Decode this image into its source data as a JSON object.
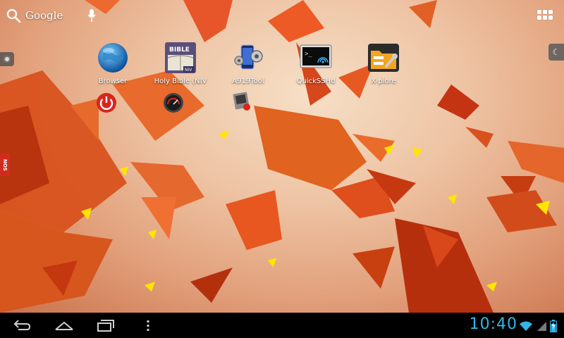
{
  "search": {
    "label": "Google"
  },
  "icons": [
    {
      "label": "Browser",
      "icon": "globe-icon"
    },
    {
      "label": "Holy Bible (NIV",
      "icon": "bible-book-icon",
      "badge_title": "BIBLE",
      "badge_sub": "NIV"
    },
    {
      "label": "A919Tool",
      "icon": "phone-gear-icon"
    },
    {
      "label": "QuickSSHd",
      "icon": "terminal-icon",
      "terminal_text": ">_"
    },
    {
      "label": "X-plore",
      "icon": "folder-tools-icon"
    }
  ],
  "second_row_icons": [
    "power-icon",
    "speedometer-icon",
    "media-player-icon"
  ],
  "side_badge": {
    "text": "NOS"
  },
  "statusbar": {
    "time": "10:40",
    "wifi": "wifi-icon",
    "battery": "battery-charging-icon"
  },
  "navbar": {
    "buttons": [
      "back-icon",
      "home-icon",
      "recent-apps-icon",
      "menu-icon"
    ]
  },
  "colors": {
    "clock": "#33b5e5",
    "wallpaper_accent": "#e0521a"
  }
}
